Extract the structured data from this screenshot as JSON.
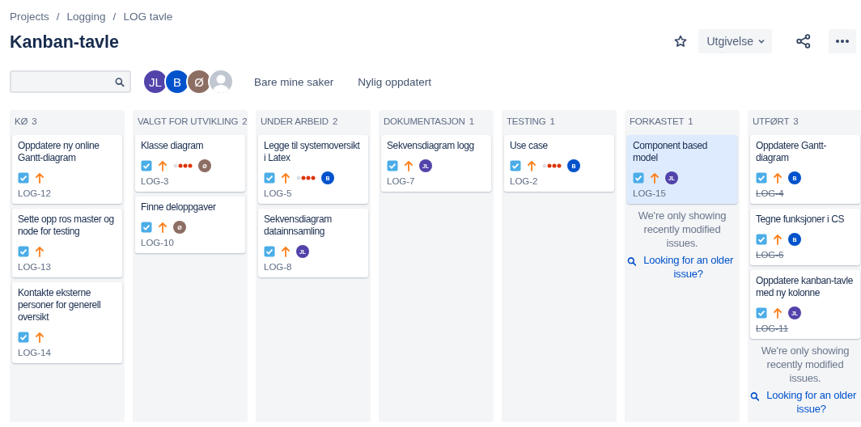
{
  "breadcrumbs": [
    "Projects",
    "Logging",
    "LOG tavle"
  ],
  "breadcrumb_separator": "/",
  "title": "Kanban-tavle",
  "header_actions": {
    "starred": false,
    "release_button": "Utgivelse"
  },
  "people": [
    {
      "kind": "initials",
      "initials": "JL",
      "color": "#5243aa"
    },
    {
      "kind": "initials",
      "initials": "B",
      "color": "#0052cc"
    },
    {
      "kind": "initials",
      "initials": "Ø",
      "color": "#8d6e63"
    },
    {
      "kind": "unassigned"
    }
  ],
  "quick_filters": [
    {
      "label": "Bare mine saker",
      "selected": false
    },
    {
      "label": "Nylig oppdatert",
      "selected": false
    }
  ],
  "columns": [
    {
      "name": "KØ",
      "count": "3",
      "cards": [
        {
          "title": "Oppdatere ny online Gantt-diagram",
          "key": "LOG-12",
          "estimate": false,
          "resolved": false,
          "selected": false
        },
        {
          "title": "Sette opp ros master og node for testing",
          "key": "LOG-13",
          "estimate": false,
          "resolved": false,
          "selected": false
        },
        {
          "title": "Kontakte eksterne personer for generell oversikt",
          "key": "LOG-14",
          "estimate": false,
          "resolved": false,
          "selected": false
        }
      ]
    },
    {
      "name": "VALGT FOR UTVIKLING",
      "count": "2",
      "cards": [
        {
          "title": "Klasse diagram",
          "key": "LOG-3",
          "estimate": true,
          "resolved": false,
          "selected": false,
          "assignee": {
            "initials": "Ø",
            "color": "#8d6e63"
          }
        },
        {
          "title": "Finne deloppgaver",
          "key": "LOG-10",
          "estimate": false,
          "resolved": false,
          "selected": false,
          "assignee": {
            "initials": "Ø",
            "color": "#8d6e63"
          }
        }
      ]
    },
    {
      "name": "UNDER ARBEID",
      "count": "2",
      "cards": [
        {
          "title": "Legge til systemoversikt i Latex",
          "key": "LOG-5",
          "estimate": true,
          "resolved": false,
          "selected": false,
          "assignee": {
            "initials": "B",
            "color": "#0052cc"
          }
        },
        {
          "title": "Sekvensdiagram datainnsamling",
          "key": "LOG-8",
          "estimate": false,
          "resolved": false,
          "selected": false,
          "assignee": {
            "initials": "JL",
            "color": "#5243aa"
          }
        }
      ]
    },
    {
      "name": "DOKUMENTASJON",
      "count": "1",
      "cards": [
        {
          "title": "Sekvensdiagram logg",
          "key": "LOG-7",
          "estimate": false,
          "resolved": false,
          "selected": false,
          "assignee": {
            "initials": "JL",
            "color": "#5243aa"
          }
        }
      ]
    },
    {
      "name": "TESTING",
      "count": "1",
      "cards": [
        {
          "title": "Use case",
          "key": "LOG-2",
          "estimate": true,
          "resolved": false,
          "selected": false,
          "assignee": {
            "initials": "B",
            "color": "#0052cc"
          }
        }
      ]
    },
    {
      "name": "FORKASTET",
      "count": "1",
      "cards": [
        {
          "title": "Component based model",
          "key": "LOG-15",
          "estimate": false,
          "resolved": false,
          "selected": true,
          "assignee": {
            "initials": "JL",
            "color": "#5243aa"
          }
        }
      ],
      "notice": "We're only showing recently modified issues.",
      "link": "Looking for an older issue?"
    },
    {
      "name": "UTFØRT",
      "count": "3",
      "cards": [
        {
          "title": "Oppdatere Gantt-diagram",
          "key": "LOG-4",
          "estimate": false,
          "resolved": true,
          "selected": false,
          "assignee": {
            "initials": "B",
            "color": "#0052cc"
          }
        },
        {
          "title": "Tegne funksjoner i CS",
          "key": "LOG-6",
          "estimate": false,
          "resolved": true,
          "selected": false,
          "assignee": {
            "initials": "B",
            "color": "#0052cc"
          }
        },
        {
          "title": "Oppdatere kanban-tavle med ny kolonne",
          "key": "LOG-11",
          "estimate": false,
          "resolved": true,
          "selected": false,
          "assignee": {
            "initials": "JL",
            "color": "#5243aa"
          }
        }
      ],
      "notice": "We're only showing recently modified issues.",
      "link": "Looking for an older issue?"
    }
  ]
}
